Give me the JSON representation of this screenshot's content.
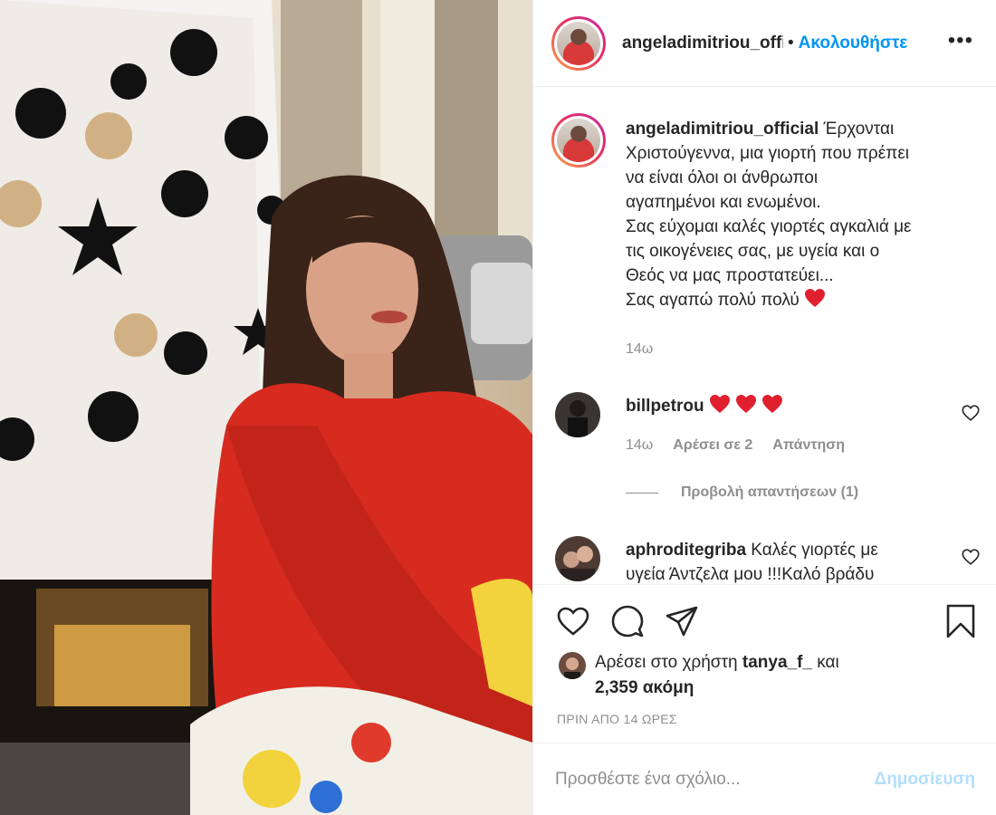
{
  "header": {
    "username": "angeladimitriou_official",
    "separator": "•",
    "follow_label": "Ακολουθήστε",
    "more_icon": "more-horizontal-icon"
  },
  "caption": {
    "username": "angeladimitriou_official",
    "lines": [
      "Έρχονται",
      "Χριστούγεννα, μια γιορτή που πρέπει",
      "να είναι όλοι οι άνθρωποι",
      "αγαπημένοι και ενωμένοι.",
      "Σας εύχομαι καλές γιορτές αγκαλιά με",
      "τις οικογένειες σας, με υγεία και ο",
      "Θεός να μας προστατεύει...",
      "Σας αγαπώ πολύ πολύ"
    ],
    "time": "14ω"
  },
  "comments": [
    {
      "username": "billpetrou",
      "text": "",
      "emoji_hearts": 3,
      "time": "14ω",
      "likes": "Αρέσει σε 2",
      "reply": "Απάντηση"
    },
    {
      "username": "aphroditegriba",
      "text_line1": "Καλές γιορτές με",
      "text_line2": "υγεία Άντζελα μου !!!Καλό βράδυ"
    }
  ],
  "view_replies": "Προβολή απαντήσεων (1)",
  "likes": {
    "prefix": "Αρέσει στο χρήστη",
    "user": "tanya_f_",
    "and": "και",
    "count": "2,359 ακόμη"
  },
  "timestamp": "ΠΡΙΝ ΑΠΟ 14 ΩΡΕΣ",
  "add_comment": {
    "placeholder": "Προσθέστε ένα σχόλιο...",
    "post_label": "Δημοσίευση"
  },
  "colors": {
    "accent": "#0095f6",
    "post_disabled": "#b2dffc",
    "heart": "#ed4956",
    "muted": "#8e8e8e"
  }
}
